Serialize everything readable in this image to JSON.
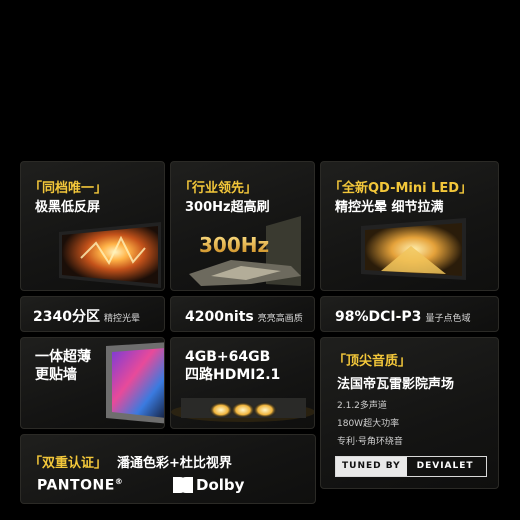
{
  "cards": {
    "c1": {
      "tag": "「同档唯一」",
      "title": "极黑低反屏"
    },
    "c2": {
      "tag": "「行业领先」",
      "title": "300Hz超高刷",
      "graphic_text": "300Hz"
    },
    "c3": {
      "tag": "「全新QD-Mini LED」",
      "title": "精控光晕  细节拉满"
    },
    "c4": {
      "main": "2340分区",
      "sub": "精控光晕"
    },
    "c5": {
      "main": "4200nits",
      "sub": "亮亮高画质"
    },
    "c6": {
      "main": "98%DCI-P3",
      "sub": "量子点色域"
    },
    "c7": {
      "line1": "一体超薄",
      "line2": "更贴墙"
    },
    "c8": {
      "line1": "4GB+64GB",
      "line2": "四路HDMI2.1"
    },
    "c9": {
      "tag": "「顶尖音质」",
      "title": "法国帝瓦雷影院声场",
      "specs": [
        "2.1.2多声道",
        "180W超大功率",
        "专利·号角环绕音"
      ],
      "badge_left": "TUNED BY",
      "badge_right": "DEVIALET"
    },
    "c10": {
      "tag": "「双重认证」",
      "title": "潘通色彩+杜比视界",
      "pantone": "PANTONE",
      "pantone_mark": "®",
      "dolby": "Dolby"
    }
  },
  "colors": {
    "accent": "#f3c73a",
    "background": "#000000",
    "card": "#161614"
  }
}
